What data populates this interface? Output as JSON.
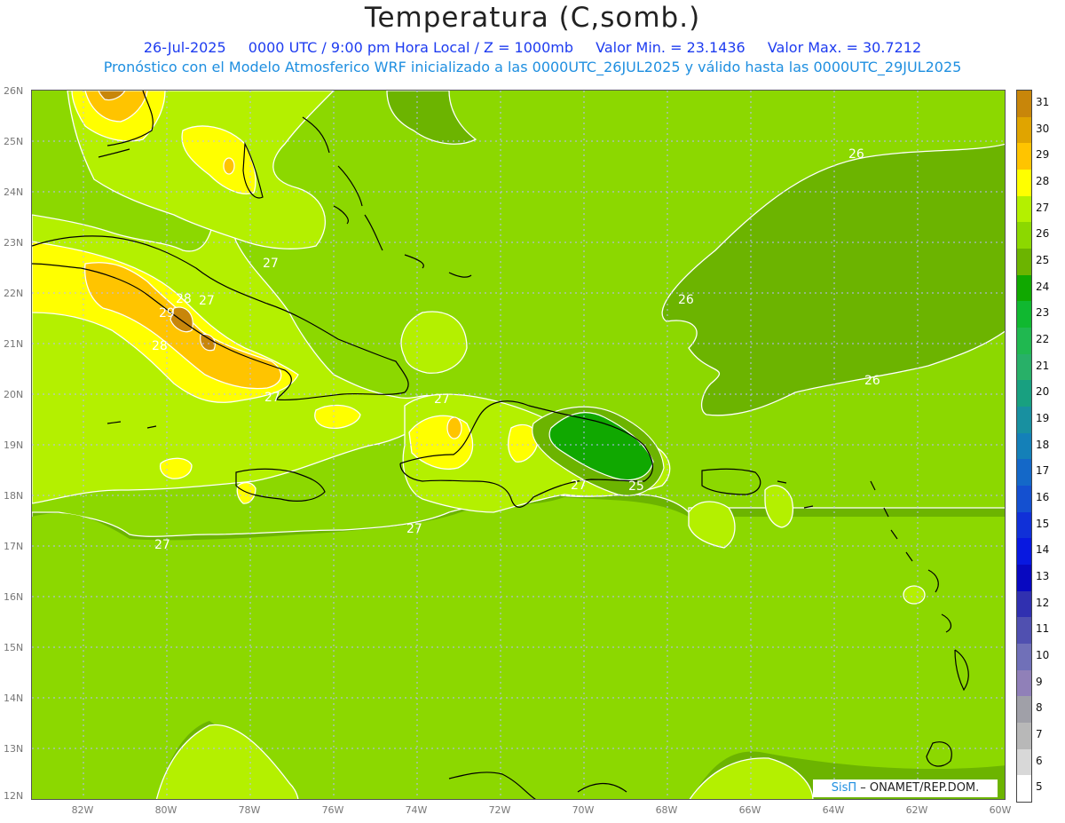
{
  "header": {
    "title": "Temperatura (C,somb.)",
    "date": "26-Jul-2025",
    "time": "0000 UTC / 9:00 pm Hora Local / Z = 1000mb",
    "min": "Valor Min. = 23.1436",
    "max": "Valor Max. = 30.7212",
    "forecast": "Pronóstico con el Modelo Atmosferico WRF inicializado a las 0000UTC_26JUL2025 y válido hasta las  0000UTC_29JUL2025"
  },
  "axes": {
    "lat_labels": [
      "26N",
      "25N",
      "24N",
      "23N",
      "22N",
      "21N",
      "20N",
      "19N",
      "18N",
      "17N",
      "16N",
      "15N",
      "14N",
      "13N",
      "12N"
    ],
    "lon_labels": [
      "82W",
      "80W",
      "78W",
      "76W",
      "74W",
      "72W",
      "70W",
      "68W",
      "66W",
      "64W",
      "62W",
      "60W"
    ]
  },
  "legend": {
    "values": [
      "31",
      "30",
      "29",
      "28",
      "27",
      "26",
      "25",
      "24",
      "23",
      "22",
      "21",
      "20",
      "19",
      "18",
      "17",
      "16",
      "15",
      "14",
      "13",
      "12",
      "11",
      "10",
      "9",
      "8",
      "7",
      "6",
      "5"
    ],
    "colors": [
      "#c8860a",
      "#e0a400",
      "#ffc400",
      "#ffff00",
      "#b4f000",
      "#8cd800",
      "#6cb400",
      "#10a800",
      "#10b830",
      "#20b850",
      "#28b068",
      "#18a080",
      "#1890a0",
      "#1480b8",
      "#1468c8",
      "#1450d0",
      "#1030d8",
      "#0818e0",
      "#0808c0",
      "#3030b0",
      "#5050b0",
      "#7070b8",
      "#9080b8",
      "#a0a0a8",
      "#b8b8b8",
      "#d8d8d8",
      "#ffffff"
    ]
  },
  "contour_labels": [
    {
      "text": "26"
    },
    {
      "text": "26"
    },
    {
      "text": "26"
    },
    {
      "text": "27"
    },
    {
      "text": "27"
    },
    {
      "text": "27"
    },
    {
      "text": "27"
    },
    {
      "text": "27"
    },
    {
      "text": "27"
    },
    {
      "text": "28"
    },
    {
      "text": "28"
    },
    {
      "text": "29"
    },
    {
      "text": "25"
    },
    {
      "text": "27"
    }
  ],
  "credit": {
    "sis": "SisΠ",
    "org": " – ONAMET/REP.DOM."
  }
}
